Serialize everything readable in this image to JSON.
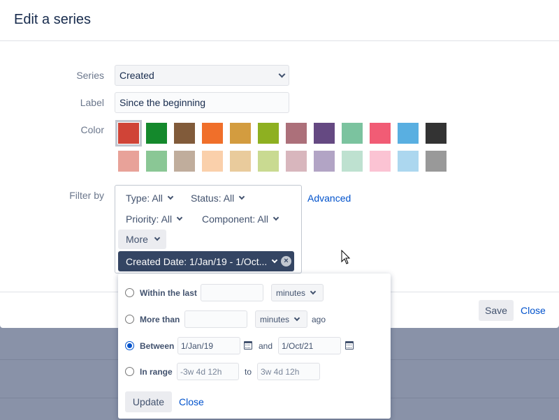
{
  "dialog": {
    "title": "Edit a series"
  },
  "form": {
    "series_label": "Series",
    "series_value": "Created",
    "label_label": "Label",
    "label_value": "Since the beginning",
    "color_label": "Color",
    "filter_label": "Filter by",
    "advanced_link": "Advanced"
  },
  "colors": {
    "row1": [
      "#d04437",
      "#14892c",
      "#815b3a",
      "#f06f2a",
      "#d39c3f",
      "#8eb021",
      "#ac707a",
      "#654982",
      "#7bc39f",
      "#f15c75",
      "#59afe1",
      "#333333"
    ],
    "row2": [
      "#e8a299",
      "#8ac795",
      "#c0ad9c",
      "#fad0ab",
      "#e9cb9c",
      "#c9da91",
      "#d8b6bd",
      "#b2a4c5",
      "#bee1d0",
      "#fbc3d3",
      "#acd7ef",
      "#999999"
    ],
    "selected_index": 0
  },
  "filters": {
    "type": "Type: All",
    "status": "Status: All",
    "priority": "Priority: All",
    "component": "Component: All",
    "more": "More",
    "created_date": "Created Date: 1/Jan/19 - 1/Oct..."
  },
  "footer": {
    "save": "Save",
    "close": "Close"
  },
  "date_popup": {
    "within_label": "Within the last",
    "within_value": "",
    "within_unit": "minutes",
    "more_than_label": "More than",
    "more_than_value": "",
    "more_than_unit": "minutes",
    "ago": "ago",
    "between_label": "Between",
    "between_from": "1/Jan/19",
    "and": "and",
    "between_to": "1/Oct/21",
    "in_range_label": "In range",
    "range_from_placeholder": "-3w 4d 12h",
    "to": "to",
    "range_to_placeholder": "3w 4d 12h",
    "selected_option": "between",
    "update": "Update",
    "close": "Close"
  },
  "icons": [
    "chevron-down-icon",
    "calendar-icon",
    "clear-icon",
    "mouse-cursor-icon"
  ]
}
